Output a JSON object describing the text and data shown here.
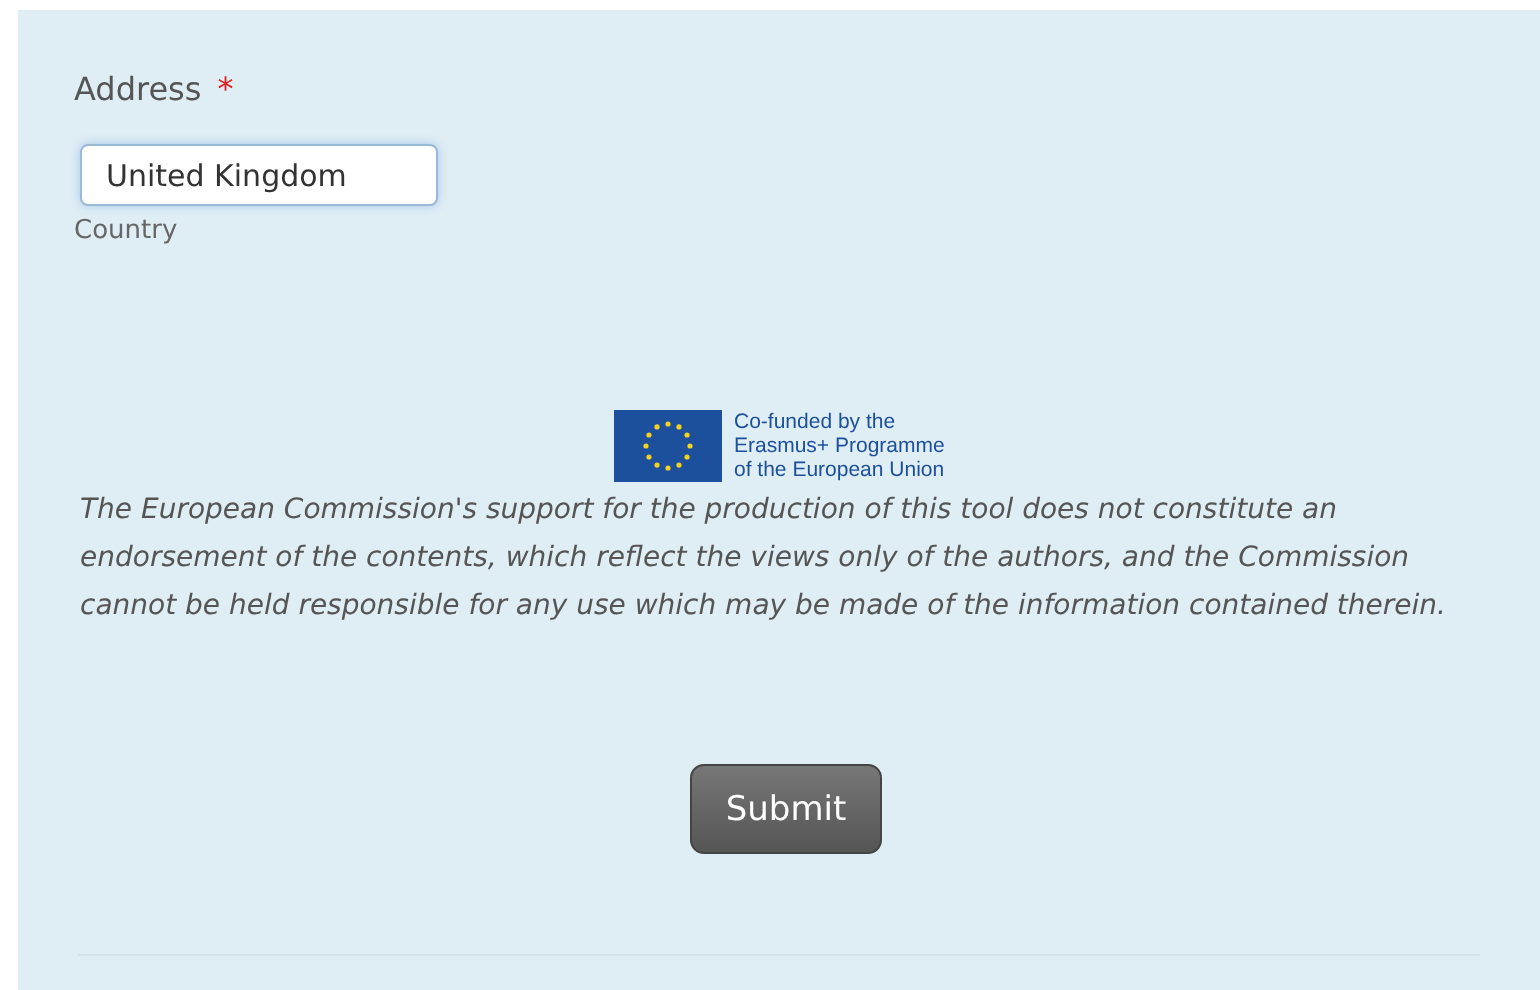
{
  "address": {
    "label": "Address",
    "required": true,
    "required_mark": "*",
    "country": {
      "value": "United Kingdom",
      "sublabel": "Country"
    }
  },
  "funding": {
    "logo_lines": [
      "Co-funded by the",
      "Erasmus+ Programme",
      "of the European Union"
    ],
    "disclaimer": "The European Commission's support for the production of this tool does not constitute an endorsement of the contents, which reflect the views only of the authors, and the Commission cannot be held responsible for any use which may be made of the information contained therein."
  },
  "submit": "Submit"
}
